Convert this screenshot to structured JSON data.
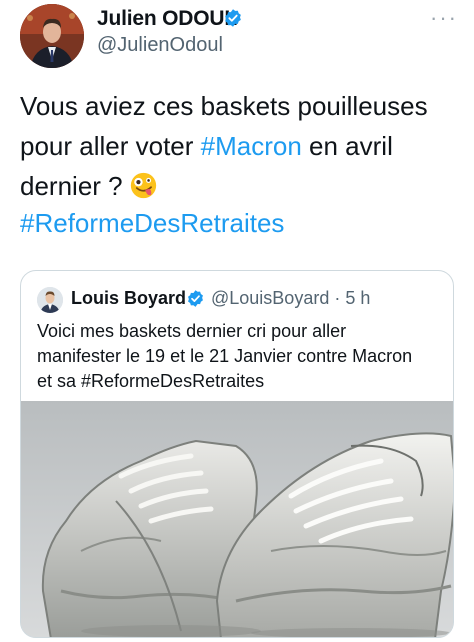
{
  "author": {
    "name": "Julien ODOUL",
    "handle": "@JulienOdoul"
  },
  "tweet": {
    "line1": "Vous aviez ces baskets pouilleuses",
    "line2_prefix": "pour aller voter ",
    "line2_hashtag": "#Macron",
    "line2_suffix": " en avril",
    "line3": "dernier ? ",
    "emoji": "zany-face-emoji",
    "hashtag": "#ReformeDesRetraites"
  },
  "quoted": {
    "name": "Louis Boyard",
    "handle_time": "@LouisBoyard · 5 h",
    "line1": "Voici mes baskets dernier cri pour aller",
    "line2": "manifester le 19 et le 21 Janvier contre Macron",
    "line3": "et sa #ReformeDesRetraites",
    "image": "worn-white-sneakers-photo"
  },
  "colors": {
    "link": "#1d9bf0",
    "verified": "#1d9bf0",
    "secondary_text": "#536471",
    "border": "#cfd9de"
  },
  "icons": [
    "verified-badge-icon",
    "more-options-icon"
  ]
}
